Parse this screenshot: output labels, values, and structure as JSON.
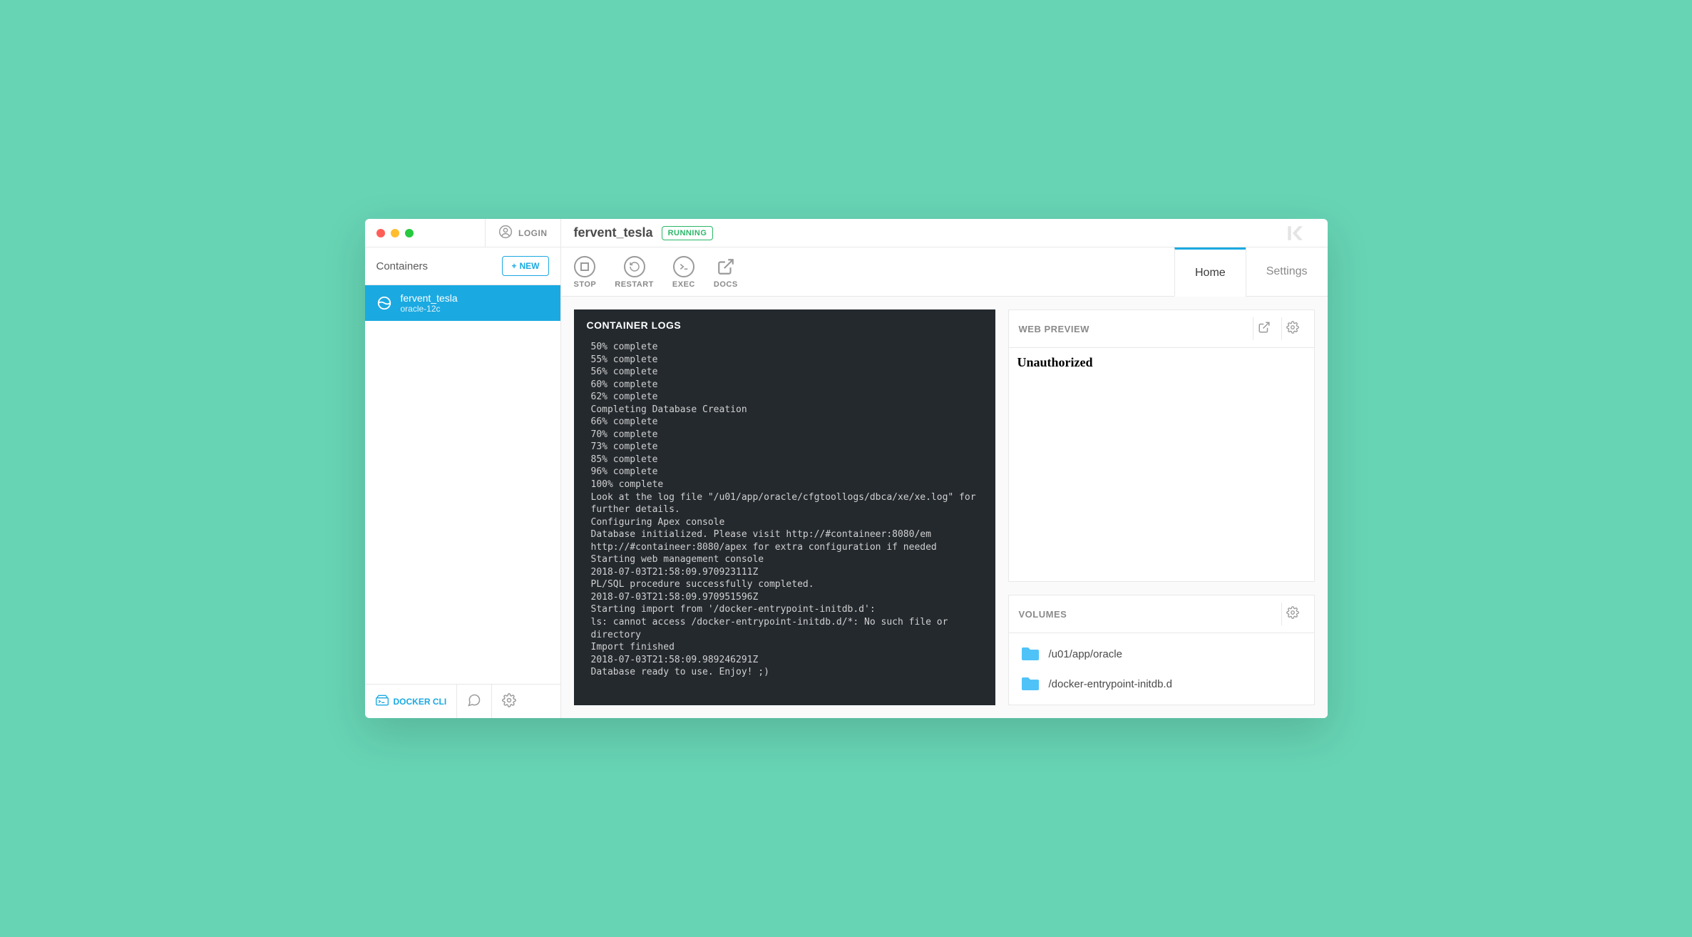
{
  "titlebar": {
    "login_label": "LOGIN",
    "container_name": "fervent_tesla",
    "status": "RUNNING",
    "brand": "K"
  },
  "sidebar": {
    "title": "Containers",
    "new_label": "NEW",
    "containers": [
      {
        "name": "fervent_tesla",
        "image": "oracle-12c"
      }
    ],
    "footer": {
      "docker_cli": "DOCKER CLI"
    }
  },
  "actions": {
    "stop": "STOP",
    "restart": "RESTART",
    "exec": "EXEC",
    "docs": "DOCS"
  },
  "tabs": {
    "home": "Home",
    "settings": "Settings"
  },
  "logs": {
    "title": "CONTAINER LOGS",
    "body": "50% complete\n55% complete\n56% complete\n60% complete\n62% complete\nCompleting Database Creation\n66% complete\n70% complete\n73% complete\n85% complete\n96% complete\n100% complete\nLook at the log file \"/u01/app/oracle/cfgtoollogs/dbca/xe/xe.log\" for further details.\nConfiguring Apex console\nDatabase initialized. Please visit http://#containeer:8080/em http://#containeer:8080/apex for extra configuration if needed\nStarting web management console\n2018-07-03T21:58:09.970923111Z\nPL/SQL procedure successfully completed.\n2018-07-03T21:58:09.970951596Z\nStarting import from '/docker-entrypoint-initdb.d':\nls: cannot access /docker-entrypoint-initdb.d/*: No such file or directory\nImport finished\n2018-07-03T21:58:09.989246291Z\nDatabase ready to use. Enjoy! ;)"
  },
  "web_preview": {
    "title": "WEB PREVIEW",
    "content": "Unauthorized"
  },
  "volumes": {
    "title": "VOLUMES",
    "items": [
      "/u01/app/oracle",
      "/docker-entrypoint-initdb.d"
    ]
  }
}
